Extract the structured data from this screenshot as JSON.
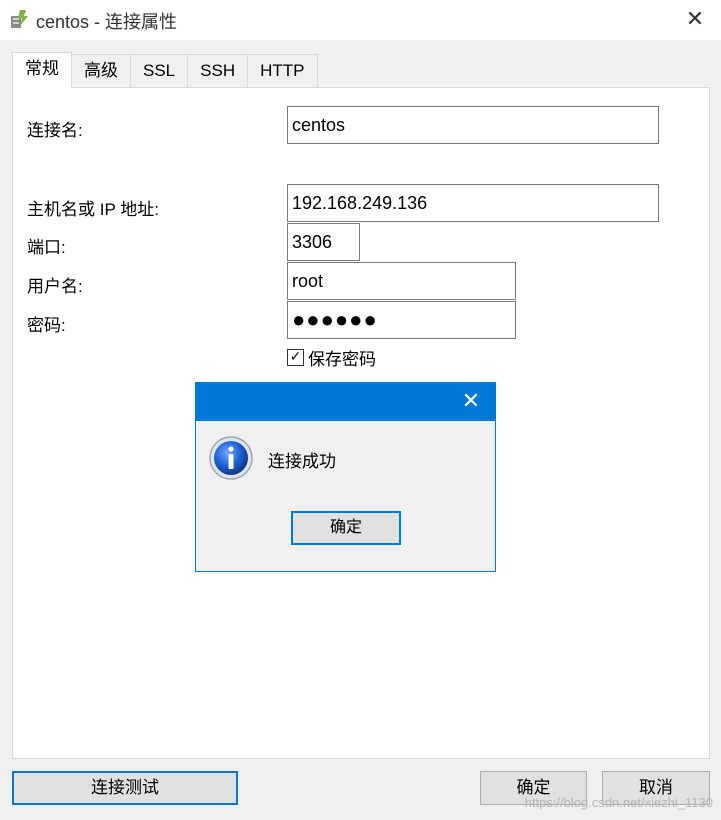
{
  "window": {
    "title": "centos - 连接属性",
    "close_glyph": "✕"
  },
  "tabs": [
    {
      "label": "常规",
      "active": true
    },
    {
      "label": "高级",
      "active": false
    },
    {
      "label": "SSL",
      "active": false
    },
    {
      "label": "SSH",
      "active": false
    },
    {
      "label": "HTTP",
      "active": false
    }
  ],
  "form": {
    "connection_name_label": "连接名:",
    "connection_name_value": "centos",
    "host_label": "主机名或 IP 地址:",
    "host_value": "192.168.249.136",
    "port_label": "端口:",
    "port_value": "3306",
    "username_label": "用户名:",
    "username_value": "root",
    "password_label": "密码:",
    "password_value": "●●●●●●",
    "save_password_label": "保存密码",
    "save_password_checked": true,
    "checkbox_glyph": "✓"
  },
  "buttons": {
    "test_connection": "连接测试",
    "ok": "确定",
    "cancel": "取消"
  },
  "messagebox": {
    "message": "连接成功",
    "ok": "确定",
    "close_glyph": "✕",
    "icon": "info-icon",
    "accent": "#0078d7"
  },
  "watermark": "https://blog.csdn.net/xiezhi_1130"
}
